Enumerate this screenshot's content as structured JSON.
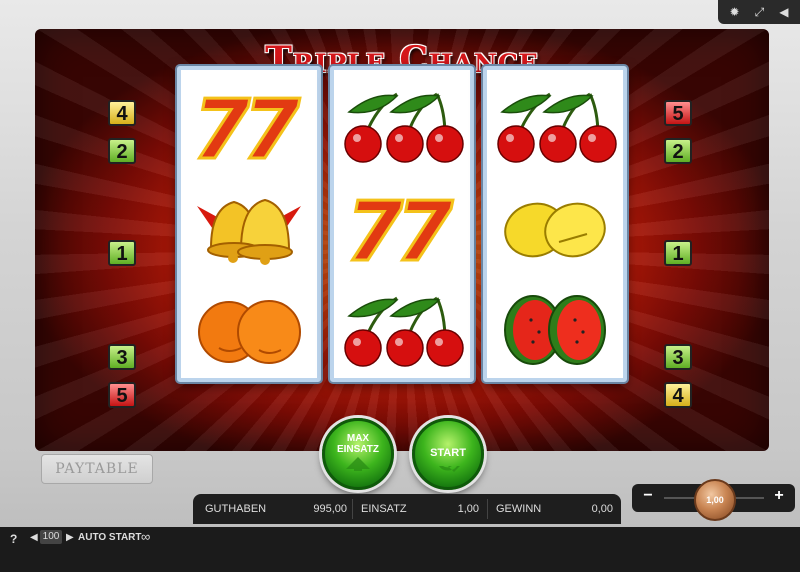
{
  "toolbar": {
    "icons": [
      "gear-icon",
      "fullscreen-icon",
      "sound-icon"
    ]
  },
  "game": {
    "title": "Triple Chance"
  },
  "line_numbers": {
    "left": [
      {
        "n": "4",
        "c": "y"
      },
      {
        "n": "2",
        "c": "g"
      },
      {
        "n": "1",
        "c": "g"
      },
      {
        "n": "3",
        "c": "g"
      },
      {
        "n": "5",
        "c": "r"
      }
    ],
    "right": [
      {
        "n": "5",
        "c": "r"
      },
      {
        "n": "2",
        "c": "g"
      },
      {
        "n": "1",
        "c": "g"
      },
      {
        "n": "3",
        "c": "g"
      },
      {
        "n": "4",
        "c": "y"
      }
    ]
  },
  "reels": [
    [
      "seven",
      "bell",
      "orange"
    ],
    [
      "cherry",
      "seven",
      "cherry"
    ],
    [
      "cherry",
      "lemon",
      "melon"
    ]
  ],
  "buttons": {
    "max_bet_line1": "MAX",
    "max_bet_line2": "EINSATZ",
    "start": "START",
    "paytable": "PAYTABLE"
  },
  "info": {
    "credit_label": "GUTHABEN",
    "credit_value": "995,00",
    "bet_label": "EINSATZ",
    "bet_value": "1,00",
    "win_label": "GEWINN",
    "win_value": "0,00"
  },
  "bet_control": {
    "minus": "−",
    "plus": "+",
    "coin_value": "1,00"
  },
  "bottom": {
    "help": "?",
    "autostart_count": "100",
    "autostart_label": "AUTO START",
    "autostart_icon": "∞"
  }
}
